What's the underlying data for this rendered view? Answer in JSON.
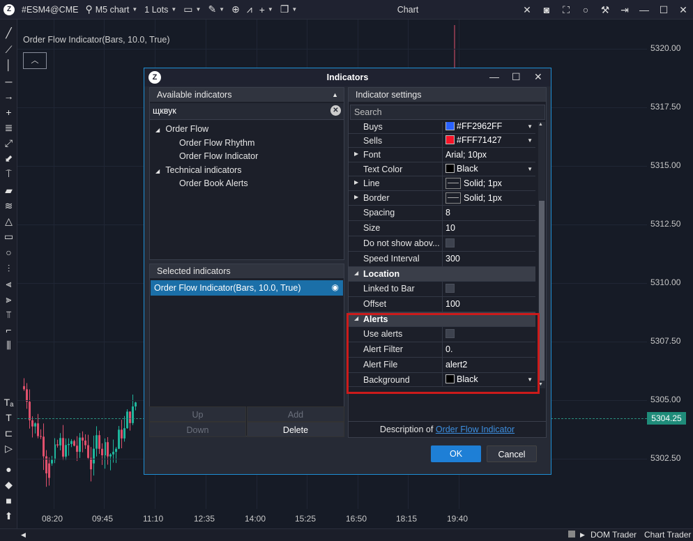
{
  "toolbar": {
    "symbol": "#ESM4@CME",
    "timeframe": "M5 chart",
    "lots": "1 Lots",
    "title": "Chart"
  },
  "chart": {
    "indicator_label": "Order Flow Indicator(Bars, 10.0, True)",
    "collapse_icon": "chevron-up-icon",
    "price_ticks": [
      "5320.00",
      "5317.50",
      "5315.00",
      "5312.50",
      "5310.00",
      "5307.50",
      "5305.00",
      "5302.50"
    ],
    "current_price": "5304.25",
    "time_ticks": [
      "08:20",
      "09:45",
      "11:10",
      "12:35",
      "14:00",
      "15:25",
      "16:50",
      "18:15",
      "19:40"
    ],
    "colors": {
      "up": "#1fb59c",
      "down": "#e0506c",
      "background": "#161b26"
    }
  },
  "bottom_bar": {
    "dom_trader": "DOM Trader",
    "chart_trader": "Chart Trader"
  },
  "dialog": {
    "title": "Indicators",
    "available": {
      "header": "Available indicators",
      "search_value": "щквук",
      "tree": [
        {
          "label": "Order Flow",
          "level": 0
        },
        {
          "label": "Order Flow Rhythm",
          "level": 1
        },
        {
          "label": "Order Flow Indicator",
          "level": 1
        },
        {
          "label": "Technical indicators",
          "level": 0
        },
        {
          "label": "Order Book Alerts",
          "level": 1
        }
      ]
    },
    "selected": {
      "header": "Selected indicators",
      "items": [
        "Order Flow Indicator(Bars, 10.0, True)"
      ]
    },
    "buttons": {
      "up": "Up",
      "add": "Add",
      "down": "Down",
      "delete": "Delete",
      "ok": "OK",
      "cancel": "Cancel"
    },
    "settings": {
      "header": "Indicator settings",
      "search_placeholder": "Search",
      "rows": [
        {
          "name": "Buys",
          "value": "#FF2962FF",
          "swatch": "#2962ff",
          "kind": "color"
        },
        {
          "name": "Sells",
          "value": "#FFF71427",
          "swatch": "#f71427",
          "kind": "color"
        },
        {
          "name": "Font",
          "value": "Arial; 10px",
          "kind": "expand"
        },
        {
          "name": "Text Color",
          "value": "Black",
          "swatch": "#000000",
          "kind": "color"
        },
        {
          "name": "Line",
          "value": "Solid; 1px",
          "kind": "line"
        },
        {
          "name": "Border",
          "value": "Solid; 1px",
          "kind": "line"
        },
        {
          "name": "Spacing",
          "value": "8",
          "kind": "text"
        },
        {
          "name": "Size",
          "value": "10",
          "kind": "text"
        },
        {
          "name": "Do not show abov...",
          "value": "",
          "kind": "check"
        },
        {
          "name": "Speed Interval",
          "value": "300",
          "kind": "text"
        },
        {
          "name": "Location",
          "kind": "category"
        },
        {
          "name": "Linked to Bar",
          "value": "",
          "kind": "check"
        },
        {
          "name": "Offset",
          "value": "100",
          "kind": "text"
        },
        {
          "name": "Alerts",
          "kind": "category"
        },
        {
          "name": "Use alerts",
          "value": "",
          "kind": "check"
        },
        {
          "name": "Alert Filter",
          "value": "0.",
          "kind": "text"
        },
        {
          "name": "Alert File",
          "value": "alert2",
          "kind": "text"
        },
        {
          "name": "Background",
          "value": "Black",
          "swatch": "#000000",
          "kind": "color"
        }
      ],
      "description_prefix": "Description of",
      "description_link": "Order Flow Indicator"
    },
    "highlight_color": "#cc1b1b"
  }
}
